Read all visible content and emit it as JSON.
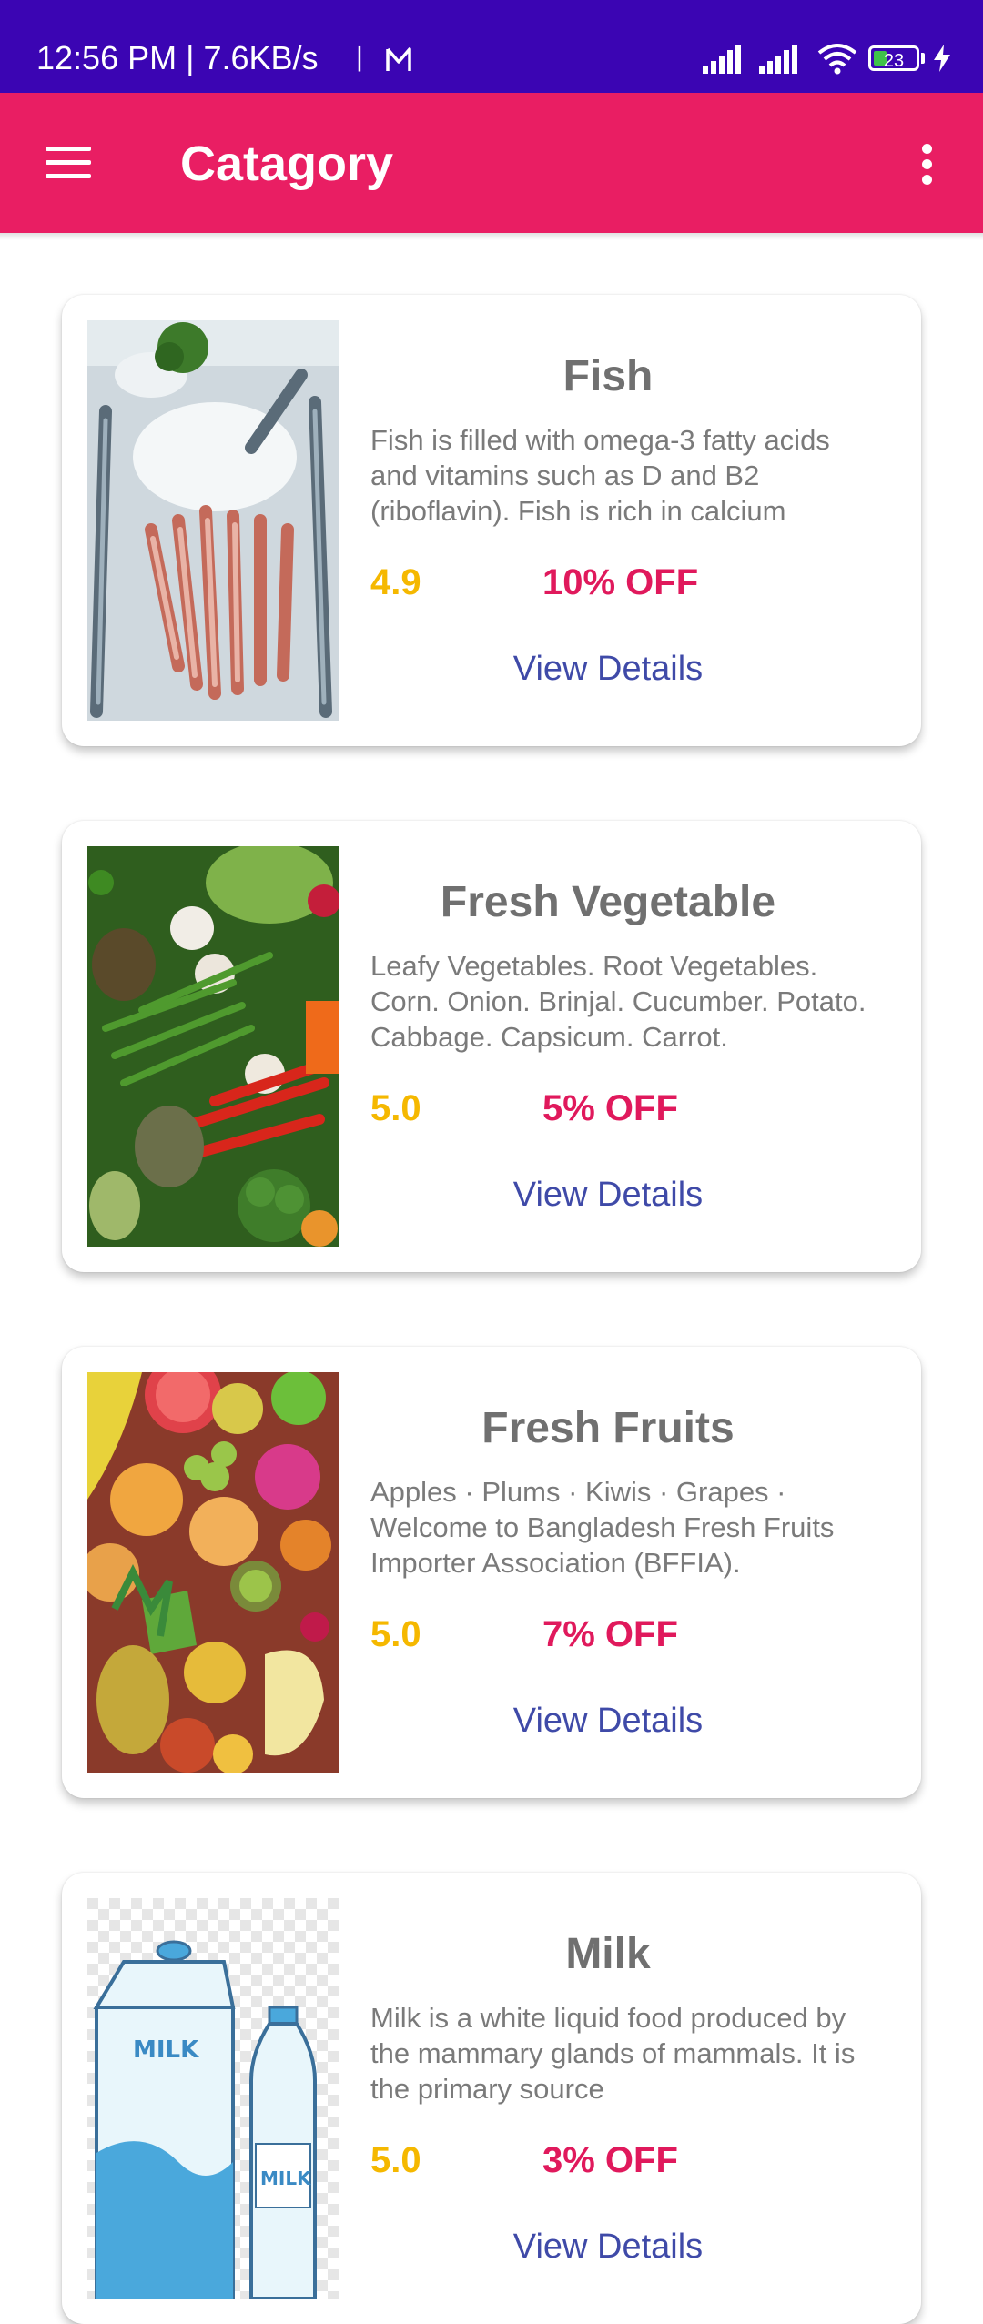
{
  "status_bar": {
    "time_text": "12:56 PM | 7.6KB/s",
    "battery_level": "23"
  },
  "app_bar": {
    "title": "Catagory",
    "menu_icon": "hamburger-menu-icon",
    "more_icon": "more-vert-icon"
  },
  "colors": {
    "status_bar": "#3b05b3",
    "app_bar": "#e91e63",
    "rating": "#f5b800",
    "discount": "#e0195c",
    "link": "#3f4aa8"
  },
  "categories": [
    {
      "title": "Fish",
      "description": "Fish is filled with omega-3 fatty acids and vitamins such as D and B2 (riboflavin). Fish is rich in calcium",
      "rating": "4.9",
      "discount": "10% OFF",
      "link_label": "View Details",
      "image": "fish-market-photo"
    },
    {
      "title": "Fresh Vegetable",
      "description": "Leafy Vegetables. Root Vegetables. Corn. Onion. Brinjal. Cucumber. Potato. Cabbage. Capsicum. Carrot.",
      "rating": "5.0",
      "discount": "5% OFF",
      "link_label": "View Details",
      "image": "vegetables-photo"
    },
    {
      "title": "Fresh Fruits",
      "description": "Apples · Plums · Kiwis · Grapes · Welcome to Bangladesh Fresh Fruits Importer Association (BFFIA).",
      "rating": "5.0",
      "discount": "7% OFF",
      "link_label": "View Details",
      "image": "fruits-photo"
    },
    {
      "title": "Milk",
      "description": "Milk is a white liquid food produced by the mammary glands of mammals. It is the primary source",
      "rating": "5.0",
      "discount": "3% OFF",
      "link_label": "View Details",
      "image": "milk-illustration",
      "image_text": "MILK"
    }
  ]
}
